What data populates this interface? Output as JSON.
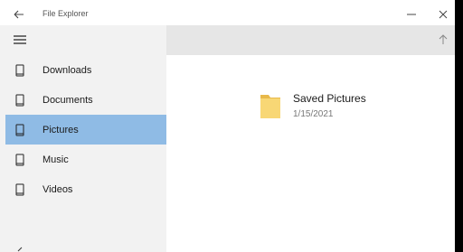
{
  "window": {
    "title": "File Explorer"
  },
  "sidebar": {
    "items": [
      {
        "label": "Downloads",
        "selected": false
      },
      {
        "label": "Documents",
        "selected": false
      },
      {
        "label": "Pictures",
        "selected": true
      },
      {
        "label": "Music",
        "selected": false
      },
      {
        "label": "Videos",
        "selected": false
      }
    ]
  },
  "content": {
    "folders": [
      {
        "name": "Saved Pictures",
        "date": "1/15/2021"
      }
    ]
  },
  "colors": {
    "accent": "#0078d7",
    "selected_item_bg": "#8fbbe5",
    "sidebar_bg": "#f2f2f2",
    "toolbar_bg": "#e6e6e6",
    "folder_yellow": "#f8d775"
  },
  "icons": {
    "back": "arrow-left-icon",
    "minimize": "minimize-icon",
    "maximize": "maximize-icon",
    "close": "close-icon",
    "menu": "hamburger-icon",
    "up": "arrow-up-icon",
    "nav_item": "phone-icon",
    "folder": "folder-icon"
  }
}
